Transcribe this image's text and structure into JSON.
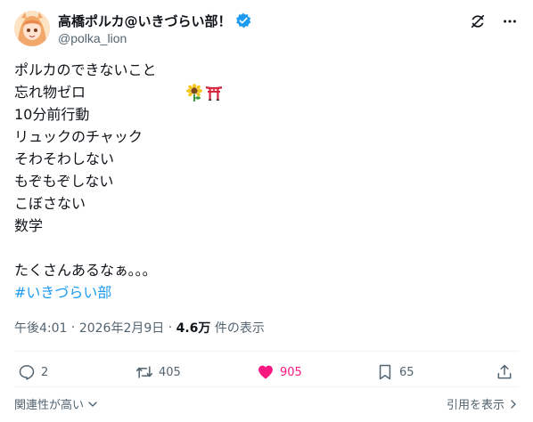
{
  "author": {
    "display_name": "高橋ポルカ@いきづらい部！",
    "handle": "@polka_lion",
    "verified": true,
    "avatar_icon": "avatar-image",
    "verified_color": "#1d9bf0"
  },
  "header_icons": [
    "grok-icon",
    "more-icon"
  ],
  "post": {
    "lines": [
      "ポルカのできないこと",
      "忘れ物ゼロ",
      "10分前行動",
      "リュックのチャック",
      "そわそわしない",
      "もぞもぞしない",
      "こぼさない",
      "数学",
      "",
      "たくさんあるなぁ。。。"
    ],
    "first_line_emojis": [
      "sunflower-emoji",
      "torii-emoji"
    ],
    "hashtag": "#いきづらい部"
  },
  "meta": {
    "time": "午後4:01",
    "separator": " · ",
    "date": "2026年2月9日",
    "separator2": " · ",
    "views_count": "4.6万",
    "views_label": " 件の表示"
  },
  "actions": {
    "replies": "2",
    "reposts": "405",
    "likes": "905",
    "bookmarks": "65",
    "liked": true,
    "like_color": "#f91880"
  },
  "footer": {
    "sort_label": "関連性が高い",
    "quotes_label": "引用を表示"
  }
}
